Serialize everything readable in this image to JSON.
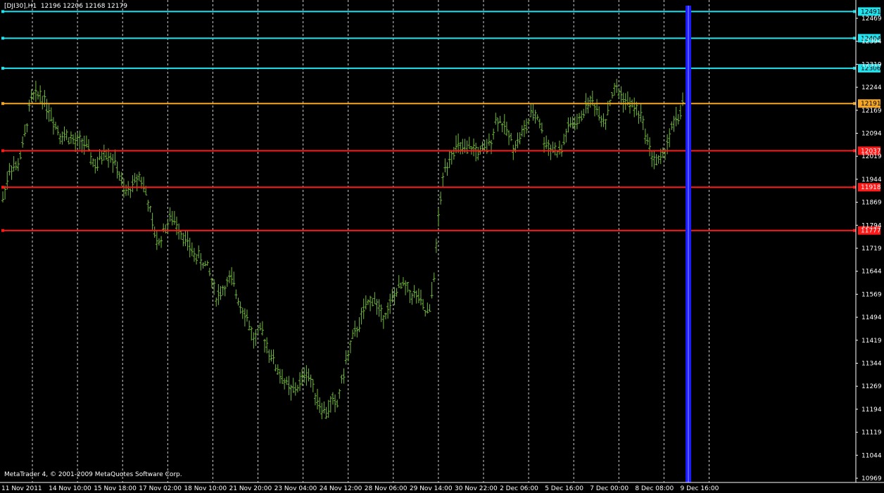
{
  "header": {
    "symbol": "[DJI30],H1",
    "ohlc": "12196 12206 12168 12179"
  },
  "copyright": "MetaTrader 4, © 2001-2009 MetaQuotes Software Corp.",
  "colors": {
    "background": "#000000",
    "bars": "#6fb83a",
    "grid": "#cfcfcf",
    "axis_text": "#ffffff",
    "resistance": "#1fe4f0",
    "current_level": "#f5a623",
    "support": "#ff1a1a",
    "period_separator": "#1a1aff"
  },
  "chart_data": {
    "type": "bar",
    "timeframe": "H1",
    "instrument": "DJI30",
    "ylim": [
      10969,
      12524
    ],
    "ytick_labels": [
      "12469",
      "12394",
      "12319",
      "12244",
      "12169",
      "12094",
      "12019",
      "11944",
      "11869",
      "11794",
      "11719",
      "11644",
      "11569",
      "11494",
      "11419",
      "11344",
      "11269",
      "11194",
      "11119",
      "11044",
      "10969"
    ],
    "xtick_labels": [
      "11 Nov 2011",
      "14 Nov 10:00",
      "15 Nov 18:00",
      "17 Nov 02:00",
      "18 Nov 10:00",
      "21 Nov 20:00",
      "23 Nov 04:00",
      "24 Nov 12:00",
      "28 Nov 06:00",
      "29 Nov 14:00",
      "30 Nov 22:00",
      "2 Dec 06:00",
      "5 Dec 16:00",
      "7 Dec 00:00",
      "8 Dec 08:00",
      "9 Dec 16:00"
    ],
    "bar_count": 310,
    "price_path": [
      [
        0,
        11880
      ],
      [
        8,
        11990
      ],
      [
        15,
        11980
      ],
      [
        22,
        12060
      ],
      [
        30,
        12205
      ],
      [
        40,
        12225
      ],
      [
        48,
        12180
      ],
      [
        55,
        12130
      ],
      [
        62,
        12090
      ],
      [
        70,
        12085
      ],
      [
        78,
        12060
      ],
      [
        85,
        12070
      ],
      [
        92,
        12030
      ],
      [
        100,
        11980
      ],
      [
        108,
        12040
      ],
      [
        115,
        12020
      ],
      [
        122,
        11985
      ],
      [
        130,
        11895
      ],
      [
        138,
        11920
      ],
      [
        146,
        11960
      ],
      [
        154,
        11890
      ],
      [
        160,
        11790
      ],
      [
        166,
        11730
      ],
      [
        172,
        11780
      ],
      [
        180,
        11820
      ],
      [
        188,
        11790
      ],
      [
        196,
        11740
      ],
      [
        204,
        11700
      ],
      [
        212,
        11680
      ],
      [
        220,
        11650
      ],
      [
        228,
        11560
      ],
      [
        236,
        11590
      ],
      [
        244,
        11620
      ],
      [
        252,
        11550
      ],
      [
        260,
        11500
      ],
      [
        268,
        11420
      ],
      [
        276,
        11450
      ],
      [
        284,
        11390
      ],
      [
        292,
        11330
      ],
      [
        300,
        11290
      ],
      [
        308,
        11250
      ],
      [
        316,
        11270
      ],
      [
        324,
        11320
      ],
      [
        330,
        11280
      ],
      [
        336,
        11230
      ],
      [
        340,
        11200
      ],
      [
        346,
        11180
      ],
      [
        352,
        11230
      ],
      [
        356,
        11190
      ],
      [
        360,
        11260
      ],
      [
        366,
        11340
      ],
      [
        372,
        11410
      ],
      [
        380,
        11470
      ],
      [
        388,
        11530
      ],
      [
        396,
        11560
      ],
      [
        404,
        11500
      ],
      [
        412,
        11520
      ],
      [
        420,
        11580
      ],
      [
        428,
        11600
      ],
      [
        436,
        11570
      ],
      [
        444,
        11560
      ],
      [
        450,
        11510
      ],
      [
        456,
        11510
      ],
      [
        462,
        11680
      ],
      [
        466,
        11850
      ],
      [
        472,
        11980
      ],
      [
        476,
        12010
      ],
      [
        480,
        12040
      ],
      [
        488,
        12050
      ],
      [
        494,
        12030
      ],
      [
        500,
        12050
      ],
      [
        508,
        12030
      ],
      [
        516,
        12040
      ],
      [
        522,
        12080
      ],
      [
        528,
        12150
      ],
      [
        534,
        12120
      ],
      [
        540,
        12090
      ],
      [
        546,
        12050
      ],
      [
        552,
        12080
      ],
      [
        558,
        12110
      ],
      [
        566,
        12160
      ],
      [
        572,
        12150
      ],
      [
        578,
        12070
      ],
      [
        584,
        12050
      ],
      [
        590,
        12040
      ],
      [
        596,
        12030
      ],
      [
        602,
        12100
      ],
      [
        608,
        12130
      ],
      [
        614,
        12120
      ],
      [
        620,
        12170
      ],
      [
        626,
        12200
      ],
      [
        632,
        12190
      ],
      [
        638,
        12150
      ],
      [
        644,
        12140
      ],
      [
        650,
        12220
      ],
      [
        656,
        12240
      ],
      [
        662,
        12210
      ],
      [
        668,
        12190
      ],
      [
        674,
        12180
      ],
      [
        680,
        12160
      ],
      [
        686,
        12100
      ],
      [
        692,
        12030
      ],
      [
        698,
        12000
      ],
      [
        704,
        12010
      ],
      [
        710,
        12070
      ],
      [
        716,
        12120
      ],
      [
        722,
        12150
      ],
      [
        726,
        12190
      ]
    ],
    "horizontal_lines": [
      {
        "label": "12491",
        "value": 12491,
        "kind": "resistance"
      },
      {
        "label": "12404",
        "value": 12404,
        "kind": "resistance"
      },
      {
        "label": "12306",
        "value": 12306,
        "kind": "resistance"
      },
      {
        "label": "12191",
        "value": 12191,
        "kind": "current"
      },
      {
        "label": "12037",
        "value": 12037,
        "kind": "support"
      },
      {
        "label": "11918",
        "value": 11918,
        "kind": "support"
      },
      {
        "label": "11777",
        "value": 11777,
        "kind": "support"
      }
    ],
    "grid": true,
    "grid_style": "vertical dashed",
    "period_separator_position": "between 9 Dec bars (right side)",
    "annotations": []
  }
}
